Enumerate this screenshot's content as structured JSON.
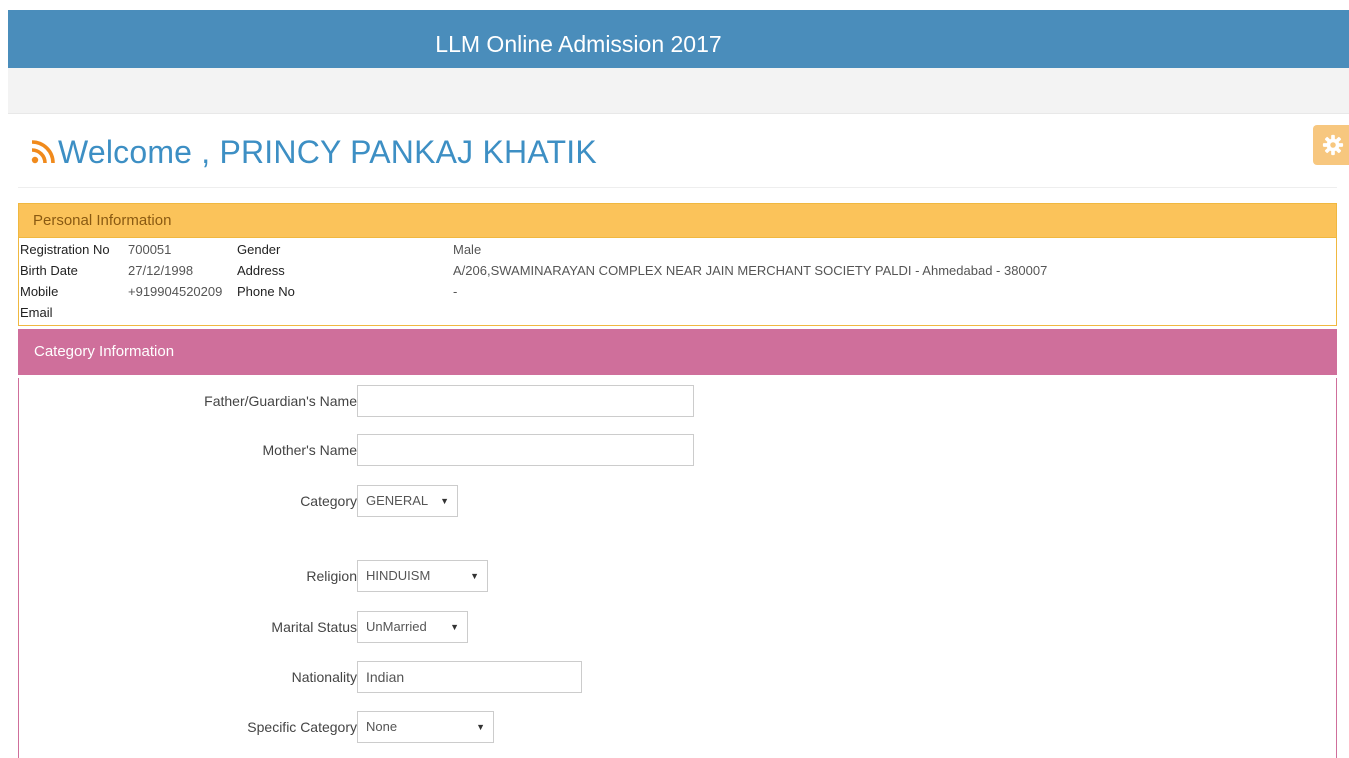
{
  "header": {
    "title": "LLM Online Admission 2017"
  },
  "welcome": {
    "text": "Welcome , PRINCY PANKAJ KHATIK"
  },
  "personal": {
    "heading": "Personal Information",
    "registration_label": "Registration No",
    "registration_value": "700051",
    "gender_label": "Gender",
    "gender_value": "Male",
    "birth_label": "Birth Date",
    "birth_value": "27/12/1998",
    "address_label": "Address",
    "address_value": "A/206,SWAMINARAYAN COMPLEX NEAR JAIN MERCHANT SOCIETY PALDI - Ahmedabad - 380007",
    "mobile_label": "Mobile",
    "mobile_value": "+919904520209",
    "phone_label": "Phone No",
    "phone_value": "-",
    "email_label": "Email"
  },
  "category": {
    "heading": "Category Information",
    "father_label": "Father/Guardian's Name",
    "father_value": "",
    "mother_label": "Mother's Name",
    "mother_value": "",
    "category_label": "Category",
    "category_value": "GENERAL",
    "religion_label": "Religion",
    "religion_value": "HINDUISM",
    "marital_label": "Marital Status",
    "marital_value": "UnMarried",
    "nationality_label": "Nationality",
    "nationality_value": "Indian",
    "specific_label": "Specific Category",
    "specific_value": "None"
  },
  "colors": {
    "header_bg": "#4a8dbb",
    "personal_bg": "#fbc35a",
    "category_bg": "#cf6f9b",
    "welcome_text": "#3d8fc4",
    "rss_icon": "#f08a1c",
    "settings_bg": "#f7c77f"
  },
  "icons": {
    "welcome": "rss-icon",
    "settings": "gear-icon",
    "select": "caret-down-icon"
  }
}
